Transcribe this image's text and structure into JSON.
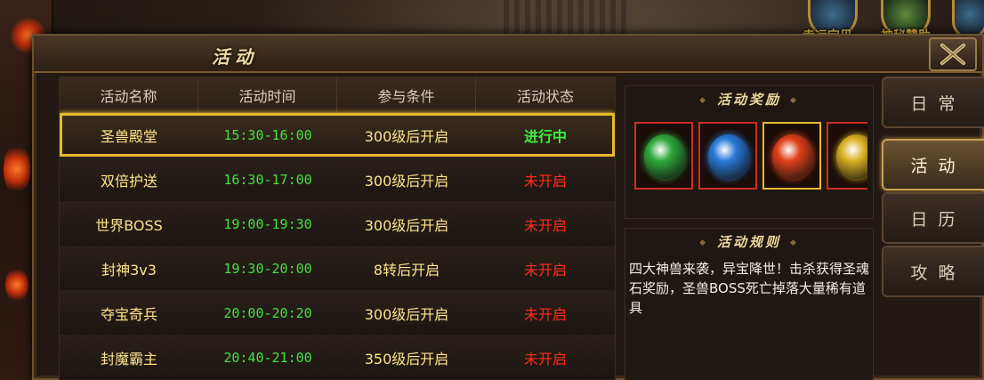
{
  "background": {
    "top_labels": [
      "幸运宝贝",
      "神秘赞助"
    ]
  },
  "window": {
    "title": "活动"
  },
  "table": {
    "headers": [
      "活动名称",
      "活动时间",
      "参与条件",
      "活动状态"
    ],
    "rows": [
      {
        "name": "圣兽殿堂",
        "time": "15:30-16:00",
        "condition": "300级后开启",
        "status": "进行中",
        "active": true
      },
      {
        "name": "双倍护送",
        "time": "16:30-17:00",
        "condition": "300级后开启",
        "status": "未开启",
        "active": false
      },
      {
        "name": "世界BOSS",
        "time": "19:00-19:30",
        "condition": "300级后开启",
        "status": "未开启",
        "active": false
      },
      {
        "name": "封神3v3",
        "time": "19:30-20:00",
        "condition": "8转后开启",
        "status": "未开启",
        "active": false
      },
      {
        "name": "夺宝奇兵",
        "time": "20:00-20:20",
        "condition": "300级后开启",
        "status": "未开启",
        "active": false
      },
      {
        "name": "封魔霸主",
        "time": "20:40-21:00",
        "condition": "350级后开启",
        "status": "未开启",
        "active": false
      }
    ],
    "selected_index": 0
  },
  "reward_panel": {
    "title": "活动奖励",
    "items": [
      {
        "icon": "green-beast-soul-stone-icon",
        "color": "#2ea83a",
        "border": "red"
      },
      {
        "icon": "blue-beast-soul-stone-icon",
        "color": "#2a7ad8",
        "border": "red"
      },
      {
        "icon": "red-beast-soul-stone-icon",
        "color": "#e0401a",
        "border": "gold"
      },
      {
        "icon": "gold-beast-soul-stone-icon",
        "color": "#d8b020",
        "border": "red"
      }
    ]
  },
  "rule_panel": {
    "title": "活动规则",
    "text": "四大神兽来袭，异宝降世！击杀获得圣魂石奖励，圣兽BOSS死亡掉落大量稀有道具"
  },
  "side_tabs": [
    {
      "label": "日常",
      "active": false
    },
    {
      "label": "活动",
      "active": true
    },
    {
      "label": "日历",
      "active": false
    },
    {
      "label": "攻略",
      "active": false
    }
  ],
  "colors": {
    "in_progress": "#3cf03c",
    "not_started": "#ff2a1a",
    "time": "#46e040",
    "name": "#ffe38a",
    "selected_border": "#e8b830"
  }
}
